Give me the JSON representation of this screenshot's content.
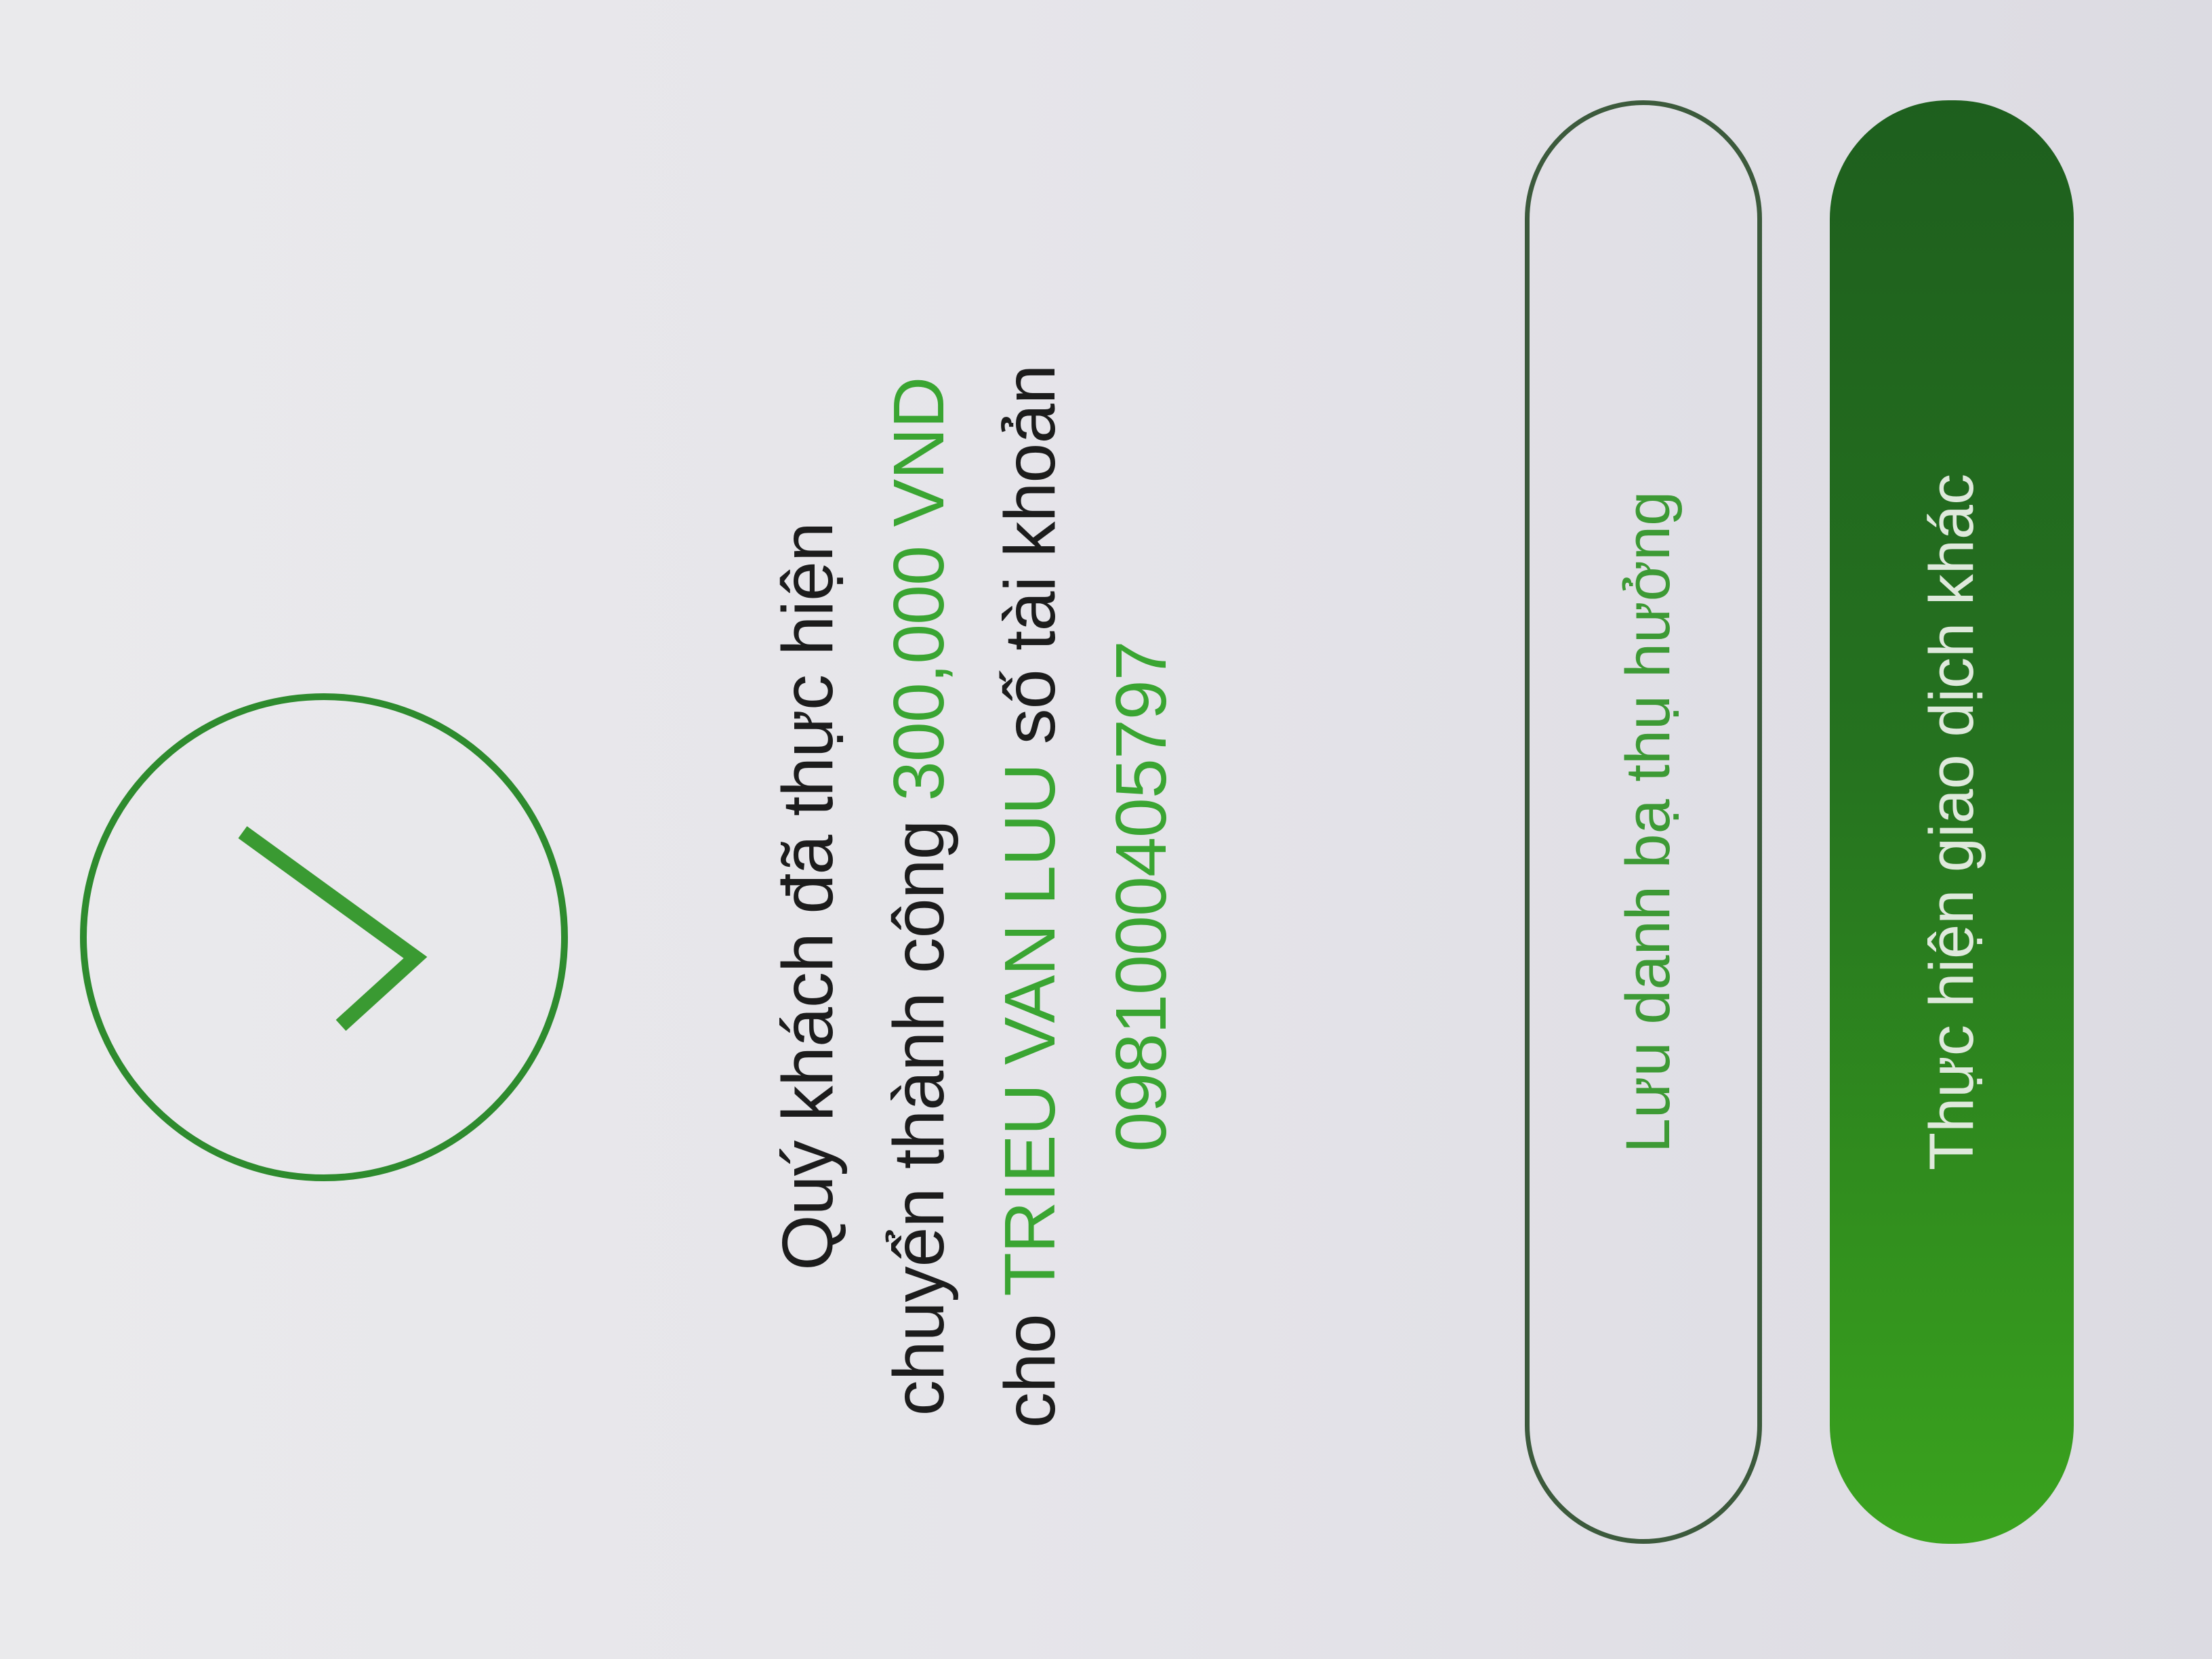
{
  "message": {
    "line1": "Quý khách đã thực hiện",
    "line2_prefix": "chuyển thành công ",
    "amount": "300,000 VND",
    "line3_prefix": "cho ",
    "recipient_name": "TRIEU VAN LUU",
    "line3_suffix": " số tài khoản",
    "account_number": "0981000405797"
  },
  "buttons": {
    "save_beneficiary_label": "Lưu danh bạ thụ hưởng",
    "new_transaction_label": "Thực hiện giao dịch khác"
  },
  "icons": {
    "status": "check-circle-icon"
  },
  "colors": {
    "accent": "#3aa532",
    "circle": "#2e8b2e",
    "primary_button_dark": "#1e5f1e",
    "primary_button_light": "#3aa31e"
  }
}
